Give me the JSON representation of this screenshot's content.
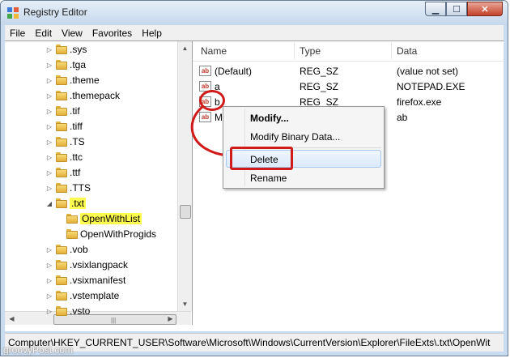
{
  "window": {
    "title": "Registry Editor"
  },
  "menu": [
    "File",
    "Edit",
    "View",
    "Favorites",
    "Help"
  ],
  "tree": {
    "items": [
      {
        "label": ".sys",
        "indent": 0,
        "expander": "collapsed"
      },
      {
        "label": ".tga",
        "indent": 0,
        "expander": "collapsed"
      },
      {
        "label": ".theme",
        "indent": 0,
        "expander": "collapsed"
      },
      {
        "label": ".themepack",
        "indent": 0,
        "expander": "collapsed"
      },
      {
        "label": ".tif",
        "indent": 0,
        "expander": "collapsed"
      },
      {
        "label": ".tiff",
        "indent": 0,
        "expander": "collapsed"
      },
      {
        "label": ".TS",
        "indent": 0,
        "expander": "collapsed"
      },
      {
        "label": ".ttc",
        "indent": 0,
        "expander": "collapsed"
      },
      {
        "label": ".ttf",
        "indent": 0,
        "expander": "collapsed"
      },
      {
        "label": ".TTS",
        "indent": 0,
        "expander": "collapsed"
      },
      {
        "label": ".txt",
        "indent": 0,
        "expander": "expanded",
        "highlight": true
      },
      {
        "label": "OpenWithList",
        "indent": 1,
        "expander": "none",
        "highlight": true
      },
      {
        "label": "OpenWithProgids",
        "indent": 1,
        "expander": "none"
      },
      {
        "label": ".vob",
        "indent": 0,
        "expander": "collapsed"
      },
      {
        "label": ".vsixlangpack",
        "indent": 0,
        "expander": "collapsed"
      },
      {
        "label": ".vsixmanifest",
        "indent": 0,
        "expander": "collapsed"
      },
      {
        "label": ".vstemplate",
        "indent": 0,
        "expander": "collapsed"
      },
      {
        "label": ".vsto",
        "indent": 0,
        "expander": "collapsed"
      }
    ]
  },
  "values": {
    "headers": [
      "Name",
      "Type",
      "Data"
    ],
    "rows": [
      {
        "name": "(Default)",
        "type": "REG_SZ",
        "data": "(value not set)"
      },
      {
        "name": "a",
        "type": "REG_SZ",
        "data": "NOTEPAD.EXE"
      },
      {
        "name": "b",
        "type": "REG_SZ",
        "data": "firefox.exe"
      },
      {
        "name": "M",
        "type": "",
        "data": "ab"
      }
    ]
  },
  "context_menu": {
    "items": [
      "Modify...",
      "Modify Binary Data...",
      "Delete",
      "Rename"
    ],
    "highlighted": "Delete"
  },
  "status": {
    "path": "Computer\\HKEY_CURRENT_USER\\Software\\Microsoft\\Windows\\CurrentVersion\\Explorer\\FileExts\\.txt\\OpenWit"
  },
  "watermark": "groovyPost.com",
  "colors": {
    "highlight": "#ffff50",
    "annotation": "#d11a1a",
    "hover": "#dceafc"
  },
  "icons": [
    "regedit-icon",
    "folder-icon",
    "string-value-icon",
    "expand-arrow-icon",
    "collapse-arrow-icon"
  ]
}
